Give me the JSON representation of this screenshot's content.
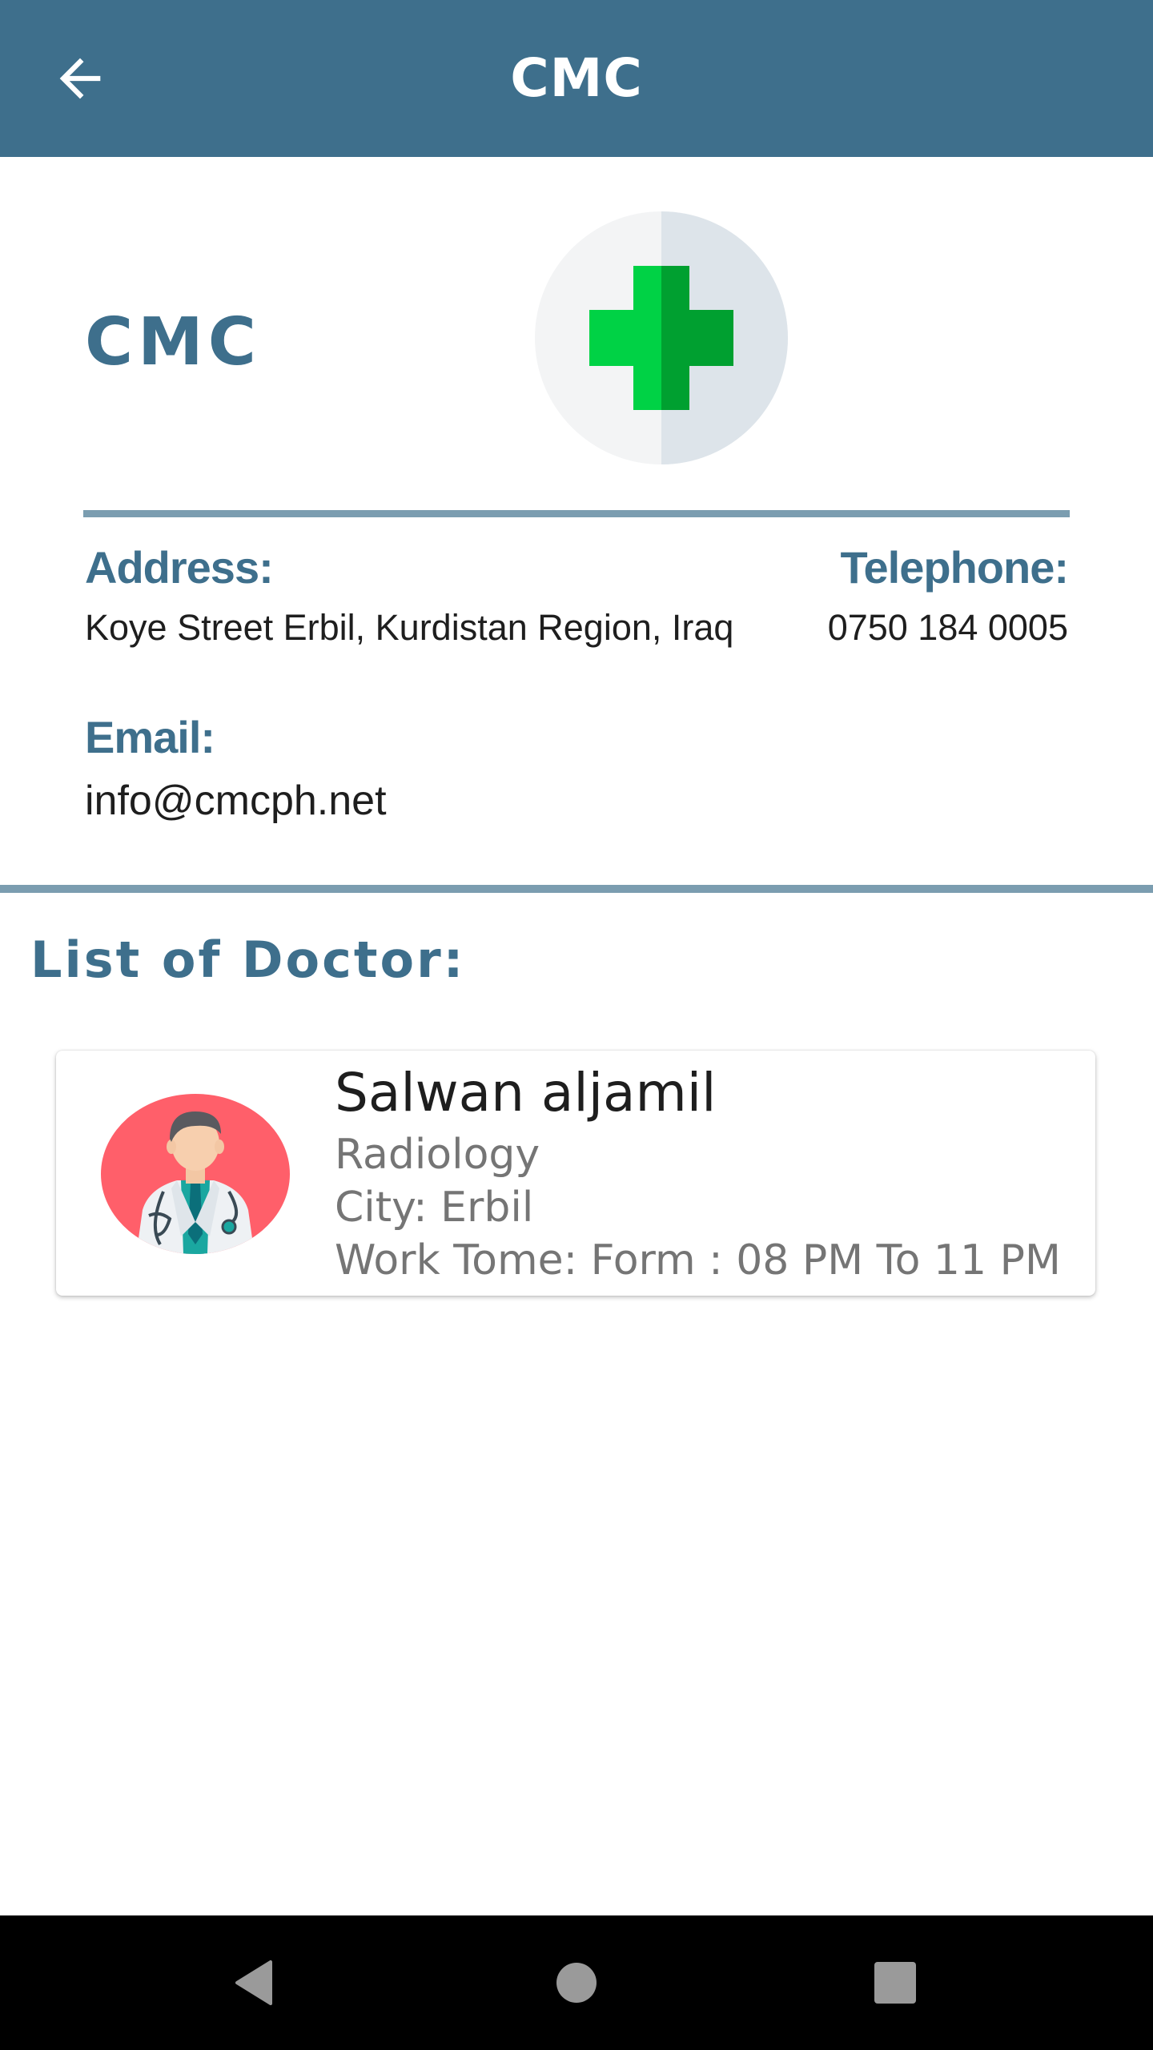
{
  "appbar": {
    "title": "CMC",
    "back_icon": "arrow-left-icon"
  },
  "clinic": {
    "name": "CMC",
    "logo_icon": "medical-cross-icon",
    "address_label": "Address:",
    "address": "Koye Street Erbil, Kurdistan Region, Iraq",
    "telephone_label": "Telephone:",
    "telephone": "0750 184 0005",
    "email_label": "Email:",
    "email": "info@cmcph.net"
  },
  "doctors": {
    "section_title": "List of Doctor:",
    "items": [
      {
        "avatar_icon": "doctor-avatar-icon",
        "name": "Salwan aljamil",
        "specialty": "Radiology",
        "city": "City: Erbil",
        "work_time": "Work Tome: Form : 08 PM To 11 PM"
      }
    ]
  },
  "navbar": {
    "back_icon": "nav-back-icon",
    "home_icon": "nav-home-icon",
    "recents_icon": "nav-recents-icon"
  },
  "colors": {
    "primary": "#3e6f8c",
    "divider": "#7b9db0",
    "cross_light": "#00d245",
    "cross_dark": "#00a030",
    "avatar_bg": "#ff5f6a"
  }
}
